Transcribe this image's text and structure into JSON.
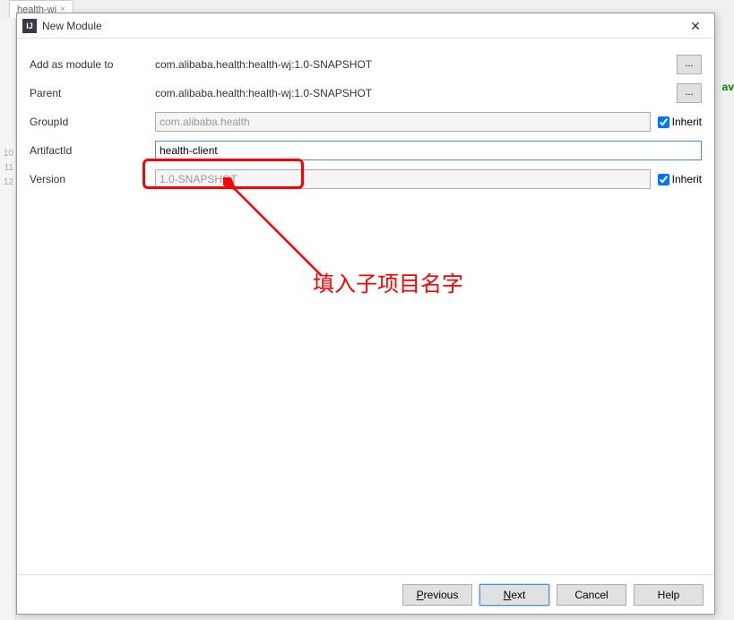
{
  "background": {
    "tab_name": "health-wj",
    "gutter_lines": [
      "",
      "",
      "",
      "",
      "",
      "",
      "",
      "",
      "",
      "10",
      "11",
      "12"
    ],
    "green_fragment": "av"
  },
  "dialog": {
    "title": "New Module",
    "icon_text": "IJ"
  },
  "form": {
    "add_module_label": "Add as module to",
    "add_module_value": "com.alibaba.health:health-wj:1.0-SNAPSHOT",
    "parent_label": "Parent",
    "parent_value": "com.alibaba.health:health-wj:1.0-SNAPSHOT",
    "groupid_label": "GroupId",
    "groupid_value": "com.alibaba.health",
    "artifactid_label": "ArtifactId",
    "artifactid_value": "health-client",
    "version_label": "Version",
    "version_value": "1.0-SNAPSHOT",
    "inherit_label": "Inherit",
    "browse_label": "..."
  },
  "annotation": {
    "text": "填入子项目名字"
  },
  "footer": {
    "previous": "Previous",
    "next": "Next",
    "cancel": "Cancel",
    "help": "Help"
  }
}
